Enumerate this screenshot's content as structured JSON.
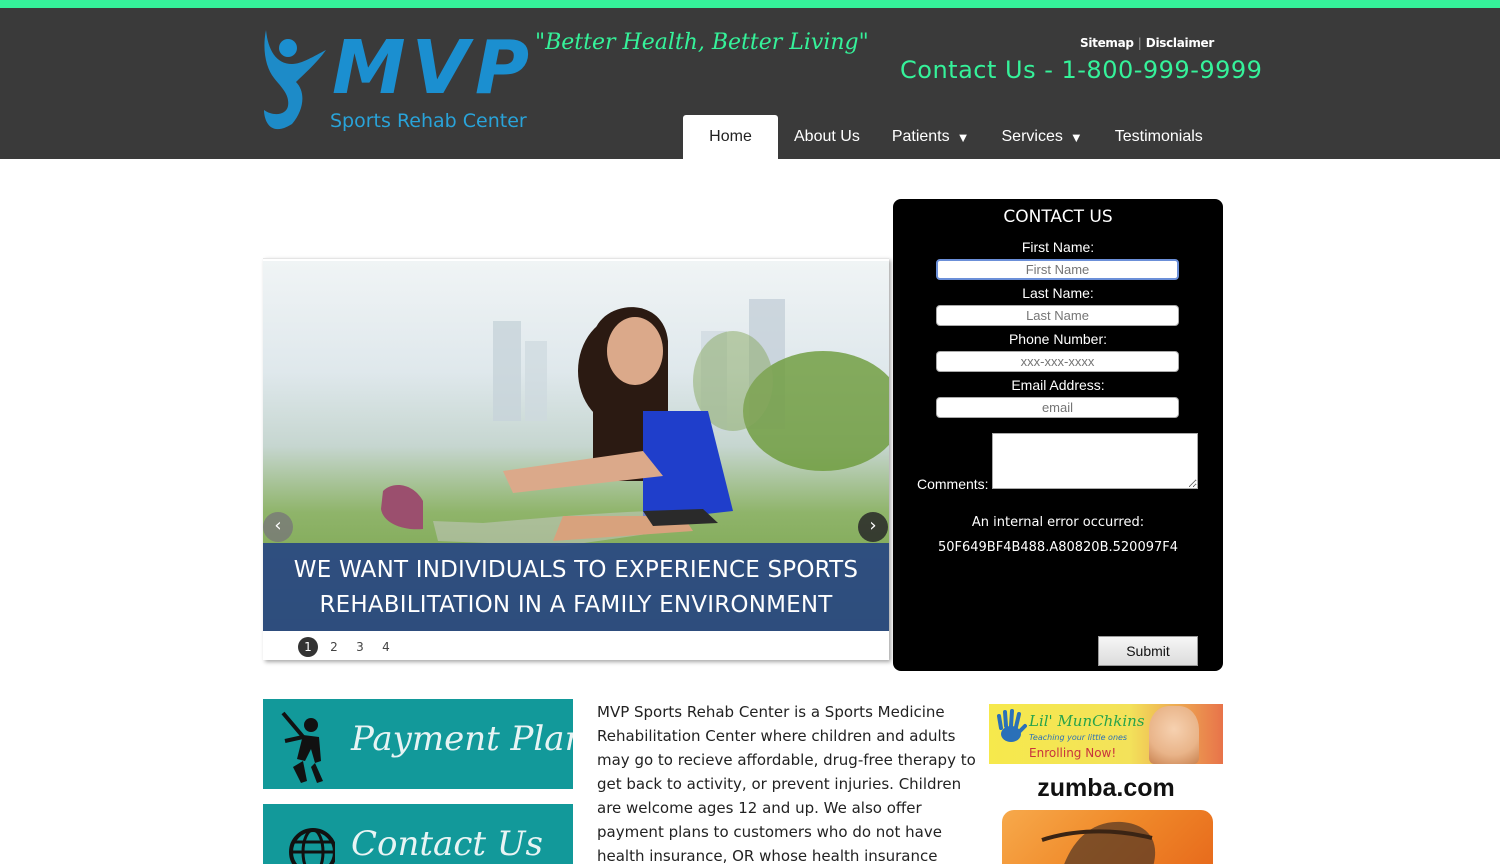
{
  "header": {
    "logo_text": "MVP",
    "logo_subtitle": "Sports Rehab Center",
    "tagline": "\"Better Health, Better Living\"",
    "util_links": [
      "Sitemap",
      "Disclaimer"
    ],
    "contact_phone": "Contact Us - 1-800-999-9999",
    "accent_color": "#35f29a",
    "header_bg": "#3a3a3a"
  },
  "nav": {
    "items": [
      {
        "label": "Home",
        "active": true
      },
      {
        "label": "About Us"
      },
      {
        "label": "Patients",
        "caret": "▼"
      },
      {
        "label": "Services",
        "caret": "▼"
      },
      {
        "label": "Testimonials"
      }
    ]
  },
  "slider": {
    "caption": "WE WANT INDIVIDUALS TO EXPERIENCE SPORTS REHABILITATION IN A FAMILY ENVIRONMENT",
    "prev": "‹",
    "next": "›",
    "pages": [
      "1",
      "2",
      "3",
      "4"
    ],
    "current_page": "1"
  },
  "contact_form": {
    "title": "CONTACT US",
    "first_name_label": "First Name:",
    "first_name_placeholder": "First Name",
    "last_name_label": "Last Name:",
    "last_name_placeholder": "Last Name",
    "phone_label": "Phone Number:",
    "phone_placeholder": "xxx-xxx-xxxx",
    "email_label": "Email Address:",
    "email_placeholder": "email",
    "comments_label": "Comments:",
    "error_line1": "An internal error occurred:",
    "error_line2": "50F649BF4B488.A80820B.520097F4",
    "submit_label": "Submit"
  },
  "promos": [
    {
      "label": "Payment Plans",
      "icon": "baseball-player-icon"
    },
    {
      "label": "Contact Us",
      "icon": "globe-icon"
    }
  ],
  "promo_color": "#12999a",
  "body_text": "MVP Sports Rehab Center is a Sports Medicine Rehabilitation Center where children and adults may go to recieve affordable, drug-free therapy to get back to activity, or prevent injuries. Children are welcome ages 12 and up. We also offer payment plans to customers who do not have health insurance, OR whose health insurance does not cover",
  "ads": {
    "munchkins_title": "Lil' MunChkins",
    "munchkins_sub": "Teaching your little ones",
    "munchkins_cta": "Enrolling Now!",
    "zumba_label": "zumba.com"
  }
}
